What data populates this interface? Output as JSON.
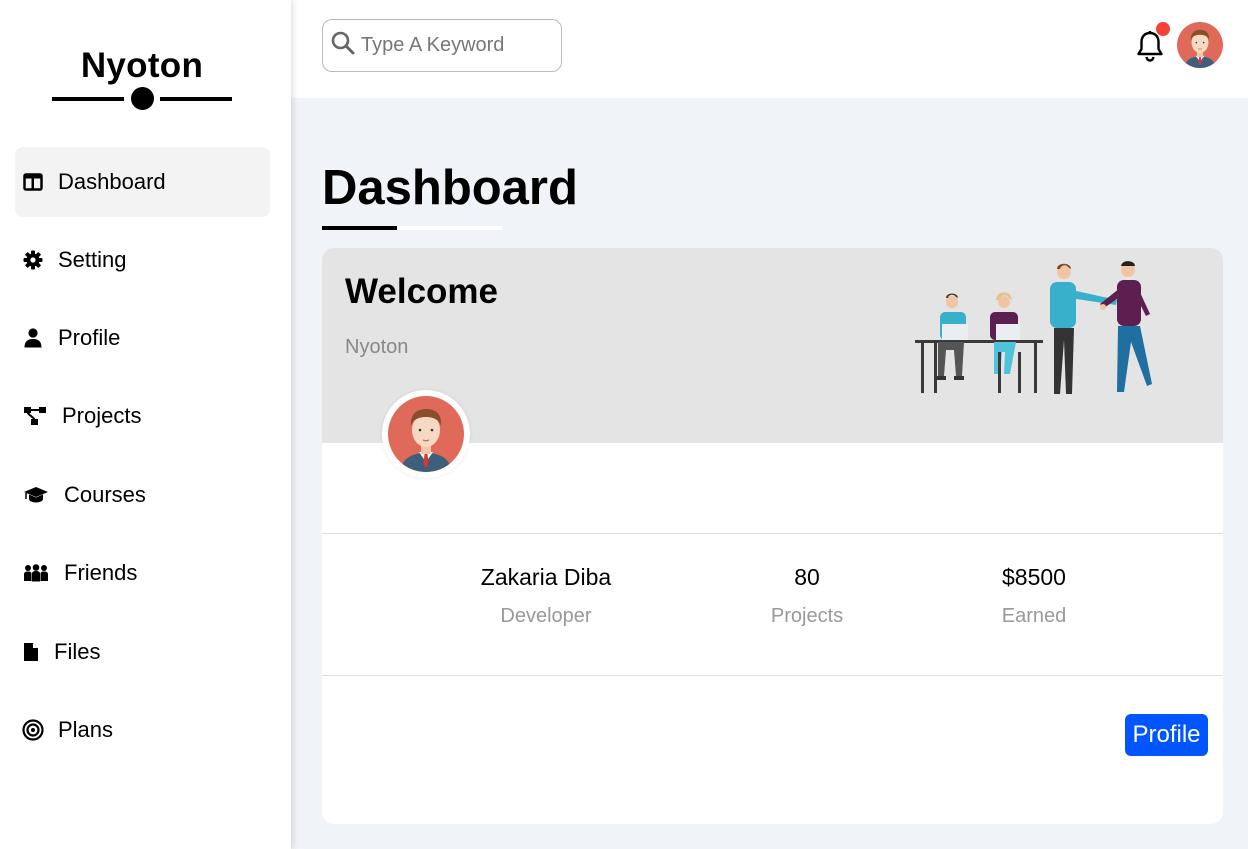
{
  "brand": {
    "name": "Nyoton"
  },
  "sidebar": {
    "items": [
      {
        "label": "Dashboard",
        "icon": "dashboard-icon",
        "active": true
      },
      {
        "label": "Setting",
        "icon": "gear-icon"
      },
      {
        "label": "Profile",
        "icon": "user-icon"
      },
      {
        "label": "Projects",
        "icon": "diagram-icon"
      },
      {
        "label": "Courses",
        "icon": "graduation-cap-icon"
      },
      {
        "label": "Friends",
        "icon": "people-icon"
      },
      {
        "label": "Files",
        "icon": "file-icon"
      },
      {
        "label": "Plans",
        "icon": "target-icon"
      }
    ]
  },
  "header": {
    "search_placeholder": "Type A Keyword",
    "notification_color": "#f44336"
  },
  "main": {
    "title": "Dashboard",
    "welcome": {
      "heading": "Welcome",
      "subtitle": "Nyoton"
    },
    "stats": [
      {
        "value": "Zakaria Diba",
        "label": "Developer"
      },
      {
        "value": "80",
        "label": "Projects"
      },
      {
        "value": "$8500",
        "label": "Earned"
      }
    ],
    "profile_button": "Profile",
    "accent_color": "#0055ff"
  }
}
